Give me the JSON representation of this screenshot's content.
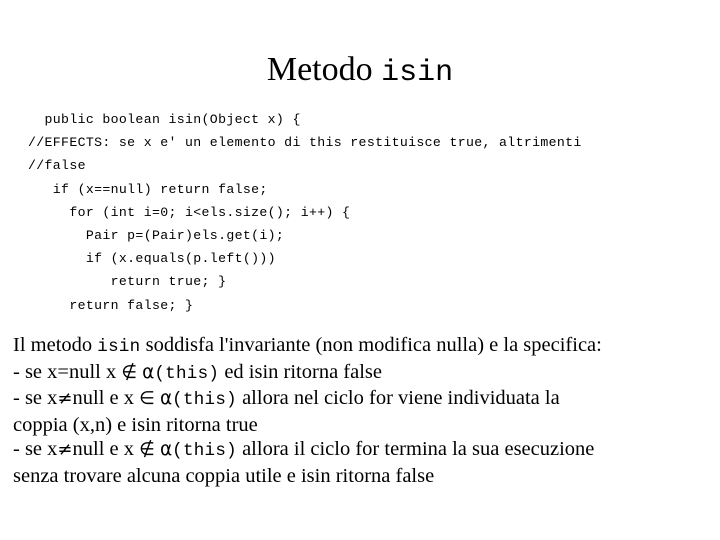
{
  "slide": {
    "background_color": "#ffffff",
    "text_color": "#000000",
    "title": {
      "serif_part": "Metodo ",
      "mono_part": "isin"
    },
    "code_block": {
      "language": "java",
      "lines": [
        "  public boolean isin(Object x) {",
        "//EFFECTS: se x e' un elemento di this restituisce true, altrimenti",
        "//false",
        "   if (x==null) return false;",
        "     for (int i=0; i<els.size(); i++) {",
        "       Pair p=(Pair)els.get(i);",
        "       if (x.equals(p.left()))",
        "          return true; }",
        "     return false; }"
      ]
    },
    "prose": {
      "lines": [
        [
          {
            "style": "serif",
            "text": "Il metodo "
          },
          {
            "style": "mono",
            "text": "isin"
          },
          {
            "style": "serif",
            "text": " soddisfa l'invariante (non modifica nulla) e la specifica:"
          }
        ],
        [
          {
            "style": "serif",
            "text": "- se x=null x "
          },
          {
            "style": "sym",
            "text": "∉"
          },
          {
            "style": "serif",
            "text": " "
          },
          {
            "style": "greek",
            "text": "α"
          },
          {
            "style": "mono",
            "text": "(this)"
          },
          {
            "style": "serif",
            "text": " ed isin ritorna false"
          }
        ],
        [
          {
            "style": "serif",
            "text": "- se x"
          },
          {
            "style": "sym",
            "text": "≠"
          },
          {
            "style": "serif",
            "text": "null e x "
          },
          {
            "style": "sym",
            "text": "∈"
          },
          {
            "style": "serif",
            "text": " "
          },
          {
            "style": "greek",
            "text": "α"
          },
          {
            "style": "mono",
            "text": "(this)"
          },
          {
            "style": "serif",
            "text": " allora nel ciclo for viene individuata la"
          }
        ],
        [
          {
            "style": "serif",
            "text": "coppia  (x,n) e isin ritorna true"
          }
        ],
        [
          {
            "style": "serif",
            "text": "- se x"
          },
          {
            "style": "sym",
            "text": "≠"
          },
          {
            "style": "serif",
            "text": "null e x "
          },
          {
            "style": "sym",
            "text": "∉"
          },
          {
            "style": "serif",
            "text": " "
          },
          {
            "style": "greek",
            "text": "α"
          },
          {
            "style": "mono",
            "text": "(this)"
          },
          {
            "style": "serif",
            "text": " allora il ciclo for termina la sua esecuzione"
          }
        ],
        [
          {
            "style": "serif",
            "text": "senza trovare alcuna coppia utile e isin ritorna false"
          }
        ]
      ]
    }
  }
}
